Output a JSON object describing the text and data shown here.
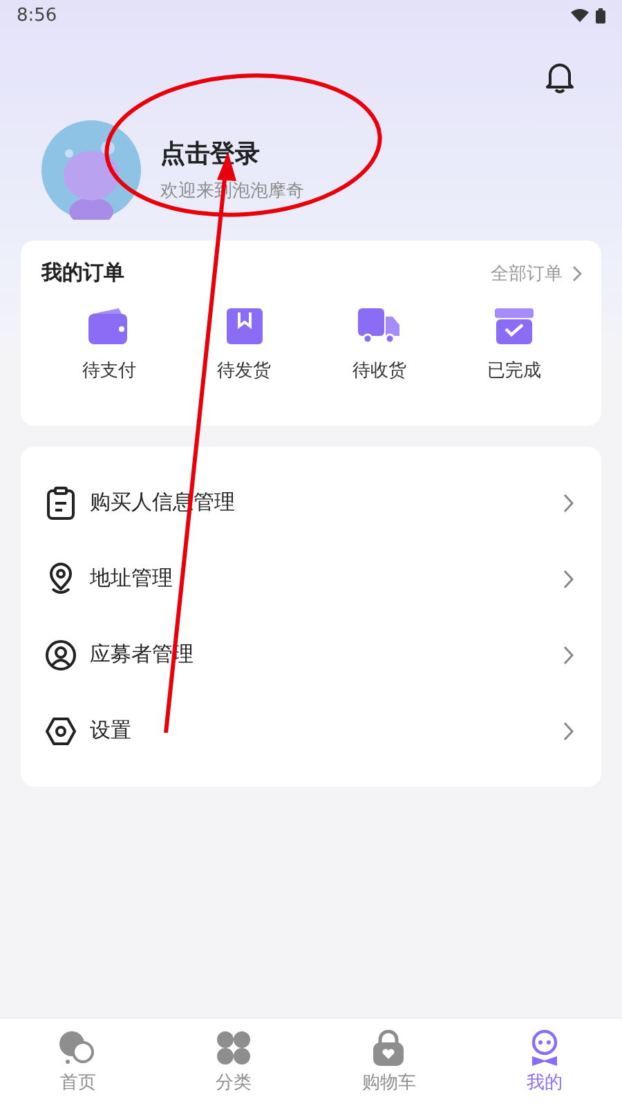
{
  "status_bar": {
    "time": "8:56"
  },
  "profile": {
    "title": "点击登录",
    "subtitle": "欢迎来到泡泡摩奇"
  },
  "orders": {
    "title": "我的订单",
    "all_link": "全部订单",
    "items": [
      {
        "label": "待支付",
        "kind": "wallet"
      },
      {
        "label": "待发货",
        "kind": "package"
      },
      {
        "label": "待收货",
        "kind": "truck"
      },
      {
        "label": "已完成",
        "kind": "box"
      }
    ]
  },
  "menu": [
    {
      "label": "购买人信息管理",
      "kind": "clipboard"
    },
    {
      "label": "地址管理",
      "kind": "pin"
    },
    {
      "label": "应募者管理",
      "kind": "person"
    },
    {
      "label": "设置",
      "kind": "settings"
    }
  ],
  "tab_bar": [
    {
      "label": "首页",
      "kind": "home",
      "selected": false
    },
    {
      "label": "分类",
      "kind": "category",
      "selected": false
    },
    {
      "label": "购物车",
      "kind": "cart",
      "selected": false
    },
    {
      "label": "我的",
      "kind": "me",
      "selected": true
    }
  ]
}
